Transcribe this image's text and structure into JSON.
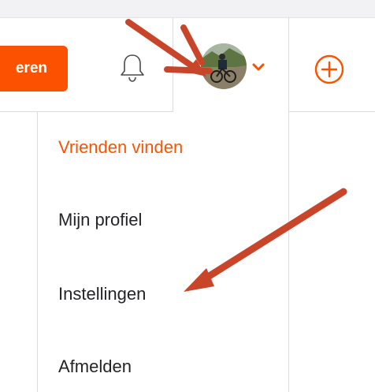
{
  "header": {
    "cta_label": "eren"
  },
  "icons": {
    "bell": "bell-icon",
    "avatar": "avatar",
    "chevron": "chevron-down-icon",
    "plus": "plus-circle-icon",
    "annotation_arrow": "arrow-icon"
  },
  "menu": {
    "items": [
      {
        "label": "Vrienden vinden",
        "active": true
      },
      {
        "label": "Mijn profiel",
        "active": false
      },
      {
        "label": "Instellingen",
        "active": false
      },
      {
        "label": "Afmelden",
        "active": false
      }
    ]
  },
  "colors": {
    "accent": "#fc5200",
    "annotation": "#c8452a",
    "text": "#242428",
    "divider": "#dcdcdf"
  }
}
